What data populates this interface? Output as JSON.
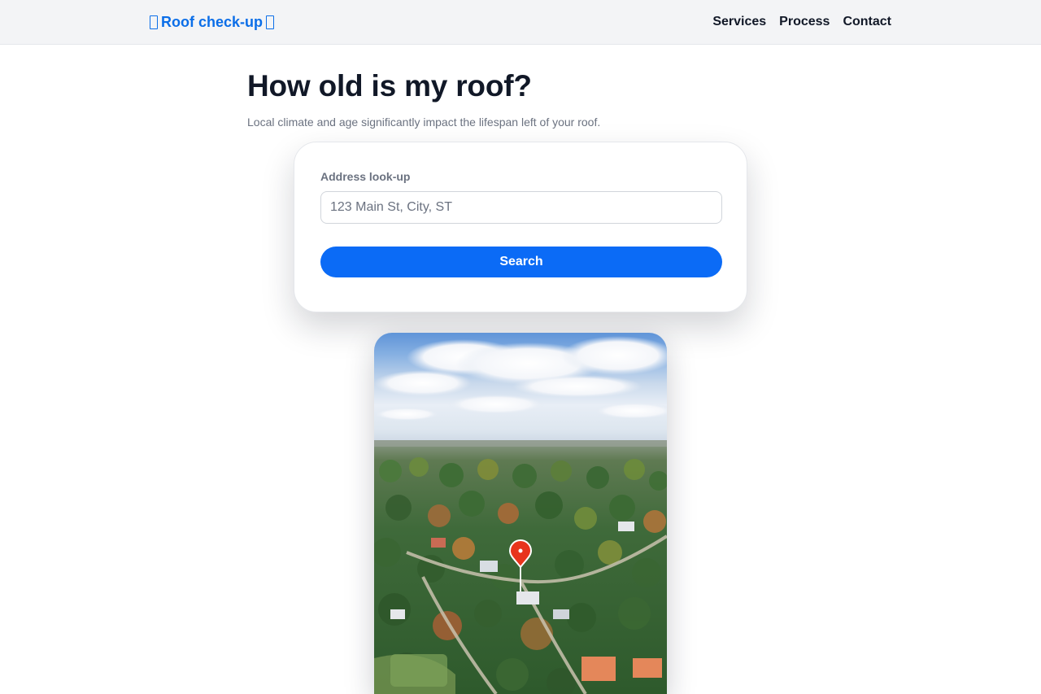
{
  "header": {
    "brand_label": "Roof check-up",
    "nav": [
      {
        "label": "Services"
      },
      {
        "label": "Process"
      },
      {
        "label": "Contact"
      }
    ]
  },
  "hero": {
    "title": "How old is my roof?",
    "subtitle": "Local climate and age significantly impact the lifespan left of your roof."
  },
  "search_card": {
    "field_label": "Address look-up",
    "input_value": "",
    "input_placeholder": "123 Main St, City, ST",
    "button_label": "Search"
  },
  "image": {
    "subject": "aerial-neighborhood-photo",
    "marker_icon": "map-pin-icon",
    "marker_color": "#e8341c"
  },
  "colors": {
    "brand": "#0b6ee8",
    "button": "#0b6bf6",
    "header_bg": "#f3f4f6",
    "heading": "#111827",
    "muted_text": "#6b7280"
  }
}
